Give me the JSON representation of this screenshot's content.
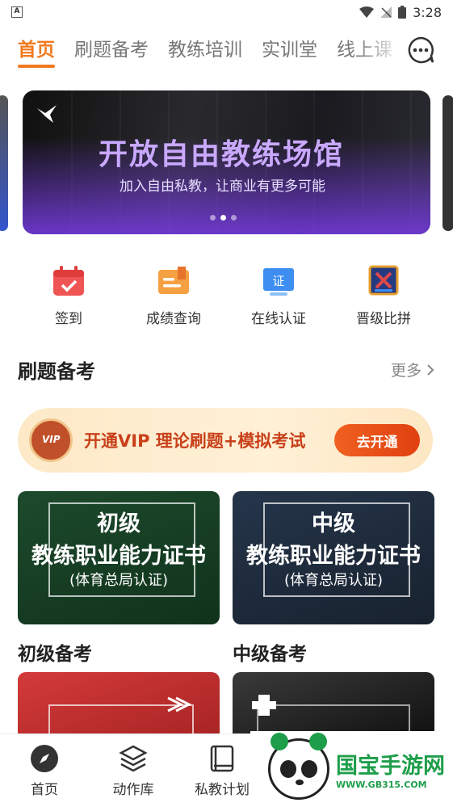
{
  "statusbar": {
    "notification_icon": "A",
    "time": "3:28"
  },
  "tabs": [
    {
      "label": "首页",
      "active": true
    },
    {
      "label": "刷题备考"
    },
    {
      "label": "教练培训"
    },
    {
      "label": "实训堂"
    },
    {
      "label": "线上课"
    }
  ],
  "banner": {
    "title": "开放自由教练场馆",
    "subtitle": "加入自由私教，让商业有更多可能",
    "page_count": 3,
    "active_page": 2
  },
  "shortcuts": [
    {
      "label": "签到",
      "icon": "calendar-check-icon"
    },
    {
      "label": "成绩查询",
      "icon": "score-card-icon"
    },
    {
      "label": "在线认证",
      "icon": "certificate-icon"
    },
    {
      "label": "晋级比拼",
      "icon": "competition-icon"
    }
  ],
  "section": {
    "title": "刷题备考",
    "more_label": "更多"
  },
  "vip": {
    "badge": "VIP",
    "text": "开通VIP 理论刷题+模拟考试",
    "button": "去开通"
  },
  "certs": [
    {
      "level": "初级",
      "name": "教练职业能力证书",
      "org": "(体育总局认证)"
    },
    {
      "level": "中级",
      "name": "教练职业能力证书",
      "org": "(体育总局认证)"
    }
  ],
  "sub_sections": [
    "初级备考",
    "中级备考"
  ],
  "tabbar": [
    {
      "label": "首页",
      "icon": "compass-icon"
    },
    {
      "label": "动作库",
      "icon": "layers-icon"
    },
    {
      "label": "私教计划",
      "icon": "book-icon"
    }
  ],
  "watermark": {
    "brand": "国宝手游网",
    "url": "WWW.GB315.COM"
  },
  "colors": {
    "accent": "#f07a20",
    "vip_text": "#c8401a",
    "watermark_green": "#1e9e4a"
  }
}
